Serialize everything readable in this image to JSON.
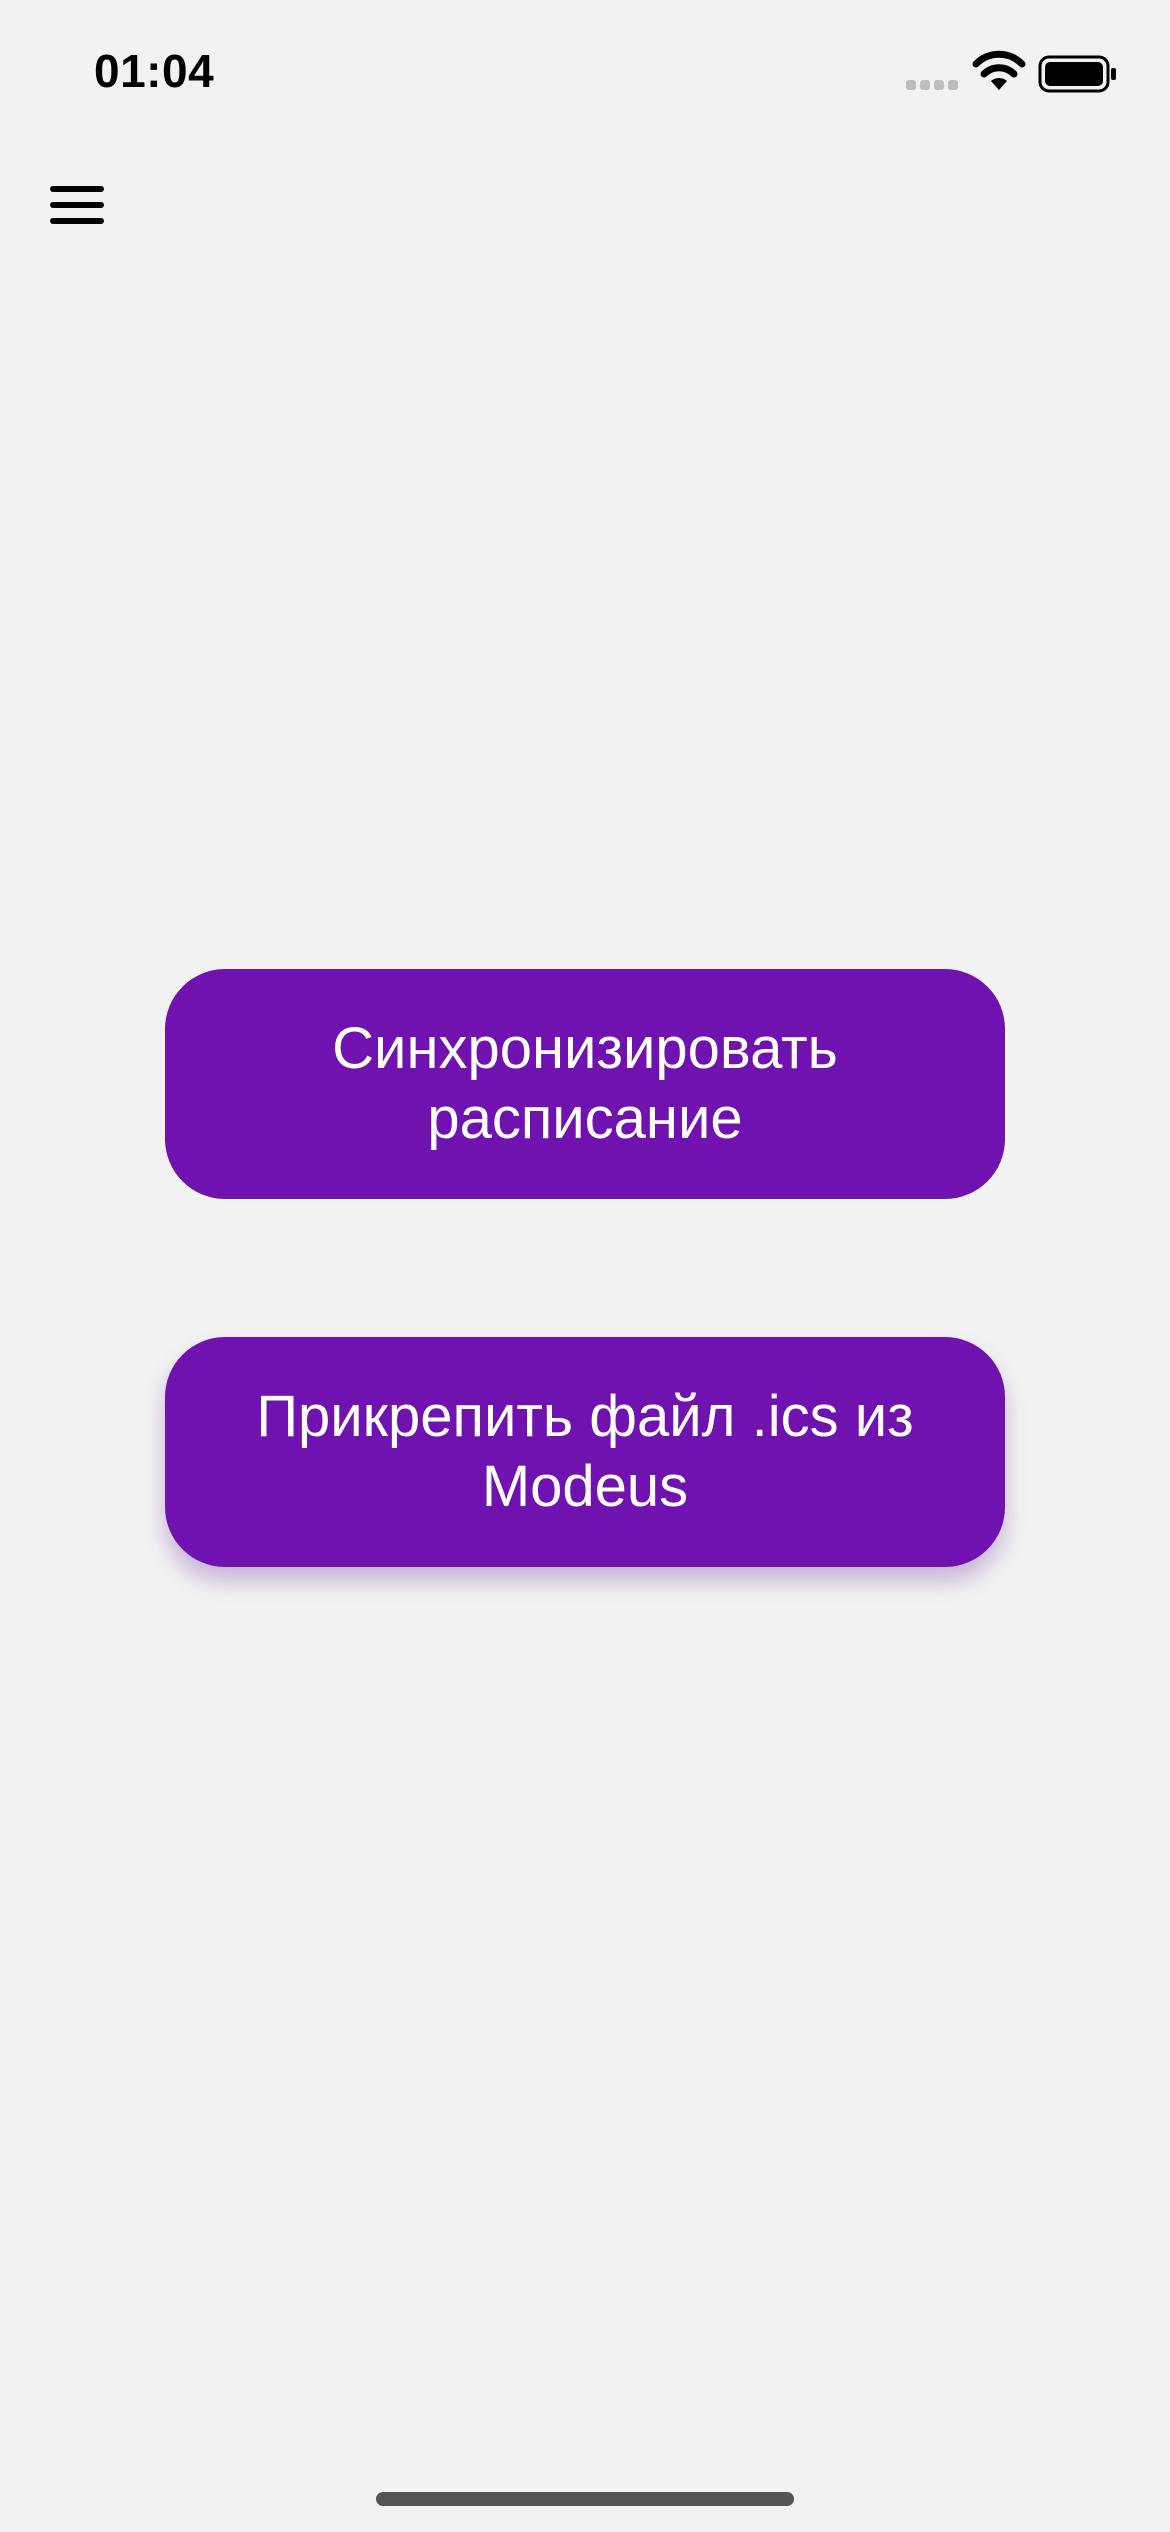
{
  "status_bar": {
    "time": "01:04",
    "icons": [
      "signal-icon",
      "wifi-icon",
      "battery-icon"
    ]
  },
  "header": {
    "menu_icon": "hamburger-menu-icon"
  },
  "main": {
    "sync_button_label": "Синхронизировать\nрасписание",
    "attach_button_label": "Прикрепить файл .ics из\nModeus"
  },
  "colors": {
    "background": "#f2f2f2",
    "accent": "#7012b0",
    "button_text": "#ffffff"
  }
}
